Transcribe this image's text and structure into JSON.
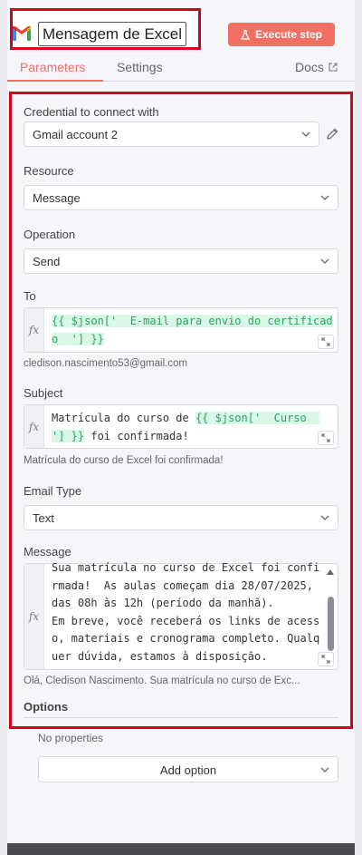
{
  "header": {
    "node_title": "Mensagem de Excel",
    "execute_label": "Execute step"
  },
  "tabs": {
    "parameters": "Parameters",
    "settings": "Settings",
    "docs": "Docs"
  },
  "form": {
    "credential": {
      "label": "Credential to connect with",
      "value": "Gmail account 2"
    },
    "resource": {
      "label": "Resource",
      "value": "Message"
    },
    "operation": {
      "label": "Operation",
      "value": "Send"
    },
    "to": {
      "label": "To",
      "line1": "{{ $json['  E-mail para envio do certificad",
      "line2": "o  '] }}",
      "hint": "cledison.nascimento53@gmail.com"
    },
    "subject": {
      "label": "Subject",
      "line1_plain": "Matrícula do curso de ",
      "line1_expr": "{{ $json['  Curso  ",
      "line2_expr": "'] }}",
      "line2_plain": " foi confirmada!",
      "hint": "Matrícula do curso de Excel foi confirmada!"
    },
    "email_type": {
      "label": "Email Type",
      "value": "Text"
    },
    "message": {
      "label": "Message",
      "lines": [
        "Sua matrícula no curso de Excel foi confi",
        "rmada!  As aulas começam dia 28/07/2025,",
        "das 08h às 12h (período da manhã).",
        "Em breve, você receberá os links de acess",
        "o, materiais e cronograma completo. Qualq",
        "uer dúvida, estamos à disposição."
      ],
      "hint": "Olá, Cledison Nascimento.   Sua matrícula no curso de Exc..."
    },
    "options": {
      "label": "Options",
      "empty_text": "No properties",
      "add_label": "Add option"
    }
  },
  "colors": {
    "accent": "#f26f64",
    "highlight_border": "#d8001a",
    "expression_bg": "#d9f6e6",
    "expression_text": "#25a85f"
  }
}
